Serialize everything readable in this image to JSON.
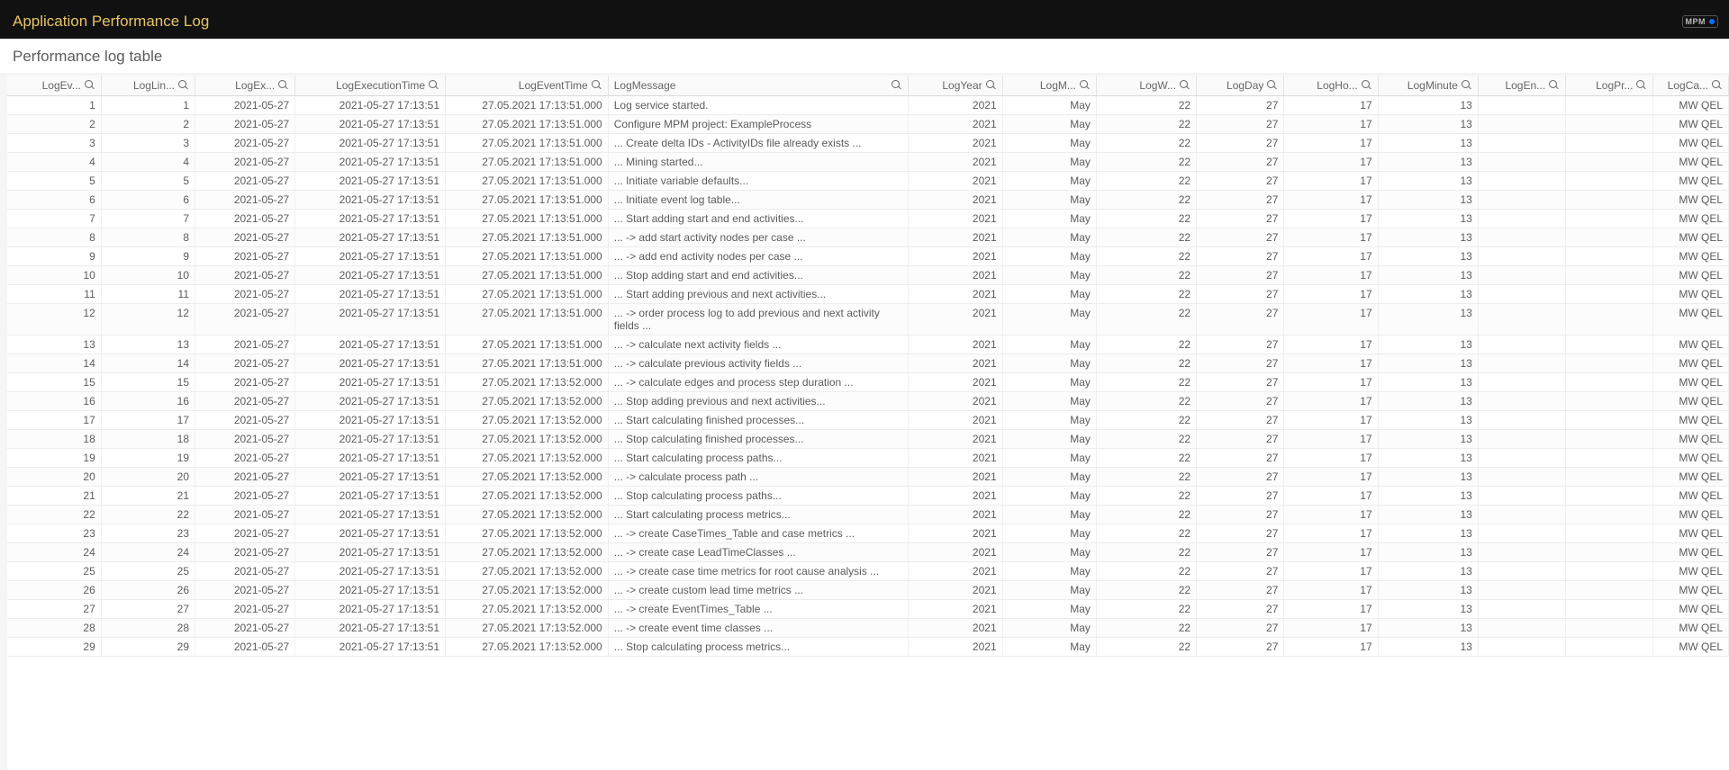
{
  "header": {
    "title": "Application Performance Log",
    "badge_label": "MPM"
  },
  "subheader": "Performance log table",
  "columns": [
    {
      "key": "ev",
      "label": "LogEv...",
      "align": "right"
    },
    {
      "key": "lin",
      "label": "LogLin...",
      "align": "right"
    },
    {
      "key": "exdt",
      "label": "LogEx...",
      "align": "right"
    },
    {
      "key": "extm",
      "label": "LogExecutionTime",
      "align": "right"
    },
    {
      "key": "evtm",
      "label": "LogEventTime",
      "align": "right"
    },
    {
      "key": "msg",
      "label": "LogMessage",
      "align": "left"
    },
    {
      "key": "year",
      "label": "LogYear",
      "align": "right"
    },
    {
      "key": "mon",
      "label": "LogM...",
      "align": "right"
    },
    {
      "key": "wk",
      "label": "LogW...",
      "align": "right"
    },
    {
      "key": "day",
      "label": "LogDay",
      "align": "right"
    },
    {
      "key": "hr",
      "label": "LogHo...",
      "align": "right"
    },
    {
      "key": "min",
      "label": "LogMinute",
      "align": "right"
    },
    {
      "key": "en",
      "label": "LogEn...",
      "align": "right"
    },
    {
      "key": "pr",
      "label": "LogPr...",
      "align": "right"
    },
    {
      "key": "ca",
      "label": "LogCa...",
      "align": "right"
    }
  ],
  "shared": {
    "exdt": "2021-05-27",
    "extm": "2021-05-27 17:13:51",
    "year": "2021",
    "mon": "May",
    "wk": "22",
    "day": "27",
    "hr": "17",
    "min": "13",
    "en": "",
    "pr": "",
    "ca": "MW QEL"
  },
  "rows": [
    {
      "ev": "1",
      "lin": "1",
      "evtm": "27.05.2021 17:13:51.000",
      "msg": "Log service started."
    },
    {
      "ev": "2",
      "lin": "2",
      "evtm": "27.05.2021 17:13:51.000",
      "msg": "Configure MPM project: ExampleProcess"
    },
    {
      "ev": "3",
      "lin": "3",
      "evtm": "27.05.2021 17:13:51.000",
      "msg": "... Create delta IDs - ActivityIDs file already exists ..."
    },
    {
      "ev": "4",
      "lin": "4",
      "evtm": "27.05.2021 17:13:51.000",
      "msg": "... Mining started..."
    },
    {
      "ev": "5",
      "lin": "5",
      "evtm": "27.05.2021 17:13:51.000",
      "msg": "... Initiate variable defaults..."
    },
    {
      "ev": "6",
      "lin": "6",
      "evtm": "27.05.2021 17:13:51.000",
      "msg": "... Initiate event log table..."
    },
    {
      "ev": "7",
      "lin": "7",
      "evtm": "27.05.2021 17:13:51.000",
      "msg": "... Start adding start and end activities..."
    },
    {
      "ev": "8",
      "lin": "8",
      "evtm": "27.05.2021 17:13:51.000",
      "msg": "... -> add start activity nodes per case ..."
    },
    {
      "ev": "9",
      "lin": "9",
      "evtm": "27.05.2021 17:13:51.000",
      "msg": "... -> add end activity nodes per case ..."
    },
    {
      "ev": "10",
      "lin": "10",
      "evtm": "27.05.2021 17:13:51.000",
      "msg": "... Stop adding start and end activities..."
    },
    {
      "ev": "11",
      "lin": "11",
      "evtm": "27.05.2021 17:13:51.000",
      "msg": "... Start adding previous and next activities..."
    },
    {
      "ev": "12",
      "lin": "12",
      "evtm": "27.05.2021 17:13:51.000",
      "msg": "... -> order process log to add previous and next activity fields ..."
    },
    {
      "ev": "13",
      "lin": "13",
      "evtm": "27.05.2021 17:13:51.000",
      "msg": "... -> calculate next activity fields ..."
    },
    {
      "ev": "14",
      "lin": "14",
      "evtm": "27.05.2021 17:13:51.000",
      "msg": "... -> calculate previous activity fields ..."
    },
    {
      "ev": "15",
      "lin": "15",
      "evtm": "27.05.2021 17:13:52.000",
      "msg": "... -> calculate edges and process step duration ..."
    },
    {
      "ev": "16",
      "lin": "16",
      "evtm": "27.05.2021 17:13:52.000",
      "msg": "... Stop adding previous and next activities..."
    },
    {
      "ev": "17",
      "lin": "17",
      "evtm": "27.05.2021 17:13:52.000",
      "msg": "... Start calculating finished processes..."
    },
    {
      "ev": "18",
      "lin": "18",
      "evtm": "27.05.2021 17:13:52.000",
      "msg": "... Stop calculating finished processes..."
    },
    {
      "ev": "19",
      "lin": "19",
      "evtm": "27.05.2021 17:13:52.000",
      "msg": "... Start calculating process paths..."
    },
    {
      "ev": "20",
      "lin": "20",
      "evtm": "27.05.2021 17:13:52.000",
      "msg": "... -> calculate process path ..."
    },
    {
      "ev": "21",
      "lin": "21",
      "evtm": "27.05.2021 17:13:52.000",
      "msg": "... Stop calculating process paths..."
    },
    {
      "ev": "22",
      "lin": "22",
      "evtm": "27.05.2021 17:13:52.000",
      "msg": "... Start calculating process metrics..."
    },
    {
      "ev": "23",
      "lin": "23",
      "evtm": "27.05.2021 17:13:52.000",
      "msg": "... -> create CaseTimes_Table and case metrics ..."
    },
    {
      "ev": "24",
      "lin": "24",
      "evtm": "27.05.2021 17:13:52.000",
      "msg": "... -> create case LeadTimeClasses ..."
    },
    {
      "ev": "25",
      "lin": "25",
      "evtm": "27.05.2021 17:13:52.000",
      "msg": "... -> create case time metrics for root cause analysis ..."
    },
    {
      "ev": "26",
      "lin": "26",
      "evtm": "27.05.2021 17:13:52.000",
      "msg": "... -> create custom lead time metrics ..."
    },
    {
      "ev": "27",
      "lin": "27",
      "evtm": "27.05.2021 17:13:52.000",
      "msg": "... -> create EventTimes_Table ..."
    },
    {
      "ev": "28",
      "lin": "28",
      "evtm": "27.05.2021 17:13:52.000",
      "msg": "... -> create event time classes ..."
    },
    {
      "ev": "29",
      "lin": "29",
      "evtm": "27.05.2021 17:13:52.000",
      "msg": "... Stop calculating process metrics..."
    }
  ]
}
